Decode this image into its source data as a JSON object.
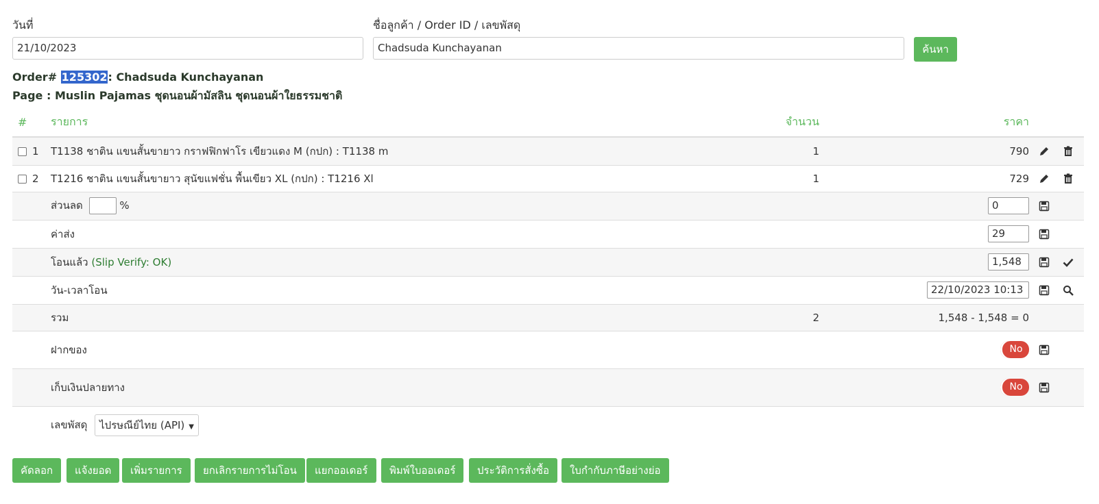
{
  "search": {
    "date_label": "วันที่",
    "date_value": "21/10/2023",
    "query_label": "ชื่อลูกค้า / Order ID / เลขพัสดุ",
    "query_value": "Chadsuda Kunchayanan",
    "search_button": "ค้นหา"
  },
  "order": {
    "prefix": "Order#",
    "id": "125302",
    "customer": ": Chadsuda Kunchayanan",
    "page_line": "Page : Muslin Pajamas ชุดนอนผ้ามัสลิน ชุดนอนผ้าใยธรรมชาติ"
  },
  "table": {
    "headers": {
      "num": "#",
      "name": "รายการ",
      "qty": "จำนวน",
      "price": "ราคา"
    },
    "items": [
      {
        "num": "1",
        "name": "T1138 ชาติน แขนสั้นขายาว กราฟฟิกฟาโร เขียวแดง M (กปก) : T1138 m",
        "qty": "1",
        "price": "790"
      },
      {
        "num": "2",
        "name": "T1216 ชาติน แขนสั้นขายาว สุนัขแฟชั่น พื้นเขียว XL (กปก) : T1216 Xl",
        "qty": "1",
        "price": "729"
      }
    ],
    "discount": {
      "label": "ส่วนลด",
      "percent_value": "",
      "percent_sign": "%",
      "value": "0"
    },
    "shipping": {
      "label": "ค่าส่ง",
      "value": "29"
    },
    "paid": {
      "label": "โอนแล้ว",
      "verify": "(Slip Verify: OK)",
      "value": "1,548"
    },
    "transfer_time": {
      "label": "วัน-เวลาโอน",
      "value": "22/10/2023 10:13"
    },
    "total": {
      "label": "รวม",
      "qty": "2",
      "value": "1,548 - 1,548 = 0"
    },
    "deposit": {
      "label": "ฝากของ",
      "toggle": "No"
    },
    "cod": {
      "label": "เก็บเงินปลายทาง",
      "toggle": "No"
    },
    "tracking": {
      "label": "เลขพัสดุ",
      "carrier": "ไปรษณีย์ไทย (API)"
    }
  },
  "actions": [
    "คัดลอก",
    "แจ้งยอด",
    "เพิ่มรายการ",
    "ยกเลิกรายการไม่โอน",
    "แยกออเดอร์",
    "พิมพ์ใบออเดอร์",
    "ประวัติการสั่งซื้อ",
    "ใบกำกับภาษีอย่างย่อ"
  ],
  "colors": {
    "accent": "#5cb85c",
    "danger": "#d9463b",
    "selection": "#3366cc"
  }
}
